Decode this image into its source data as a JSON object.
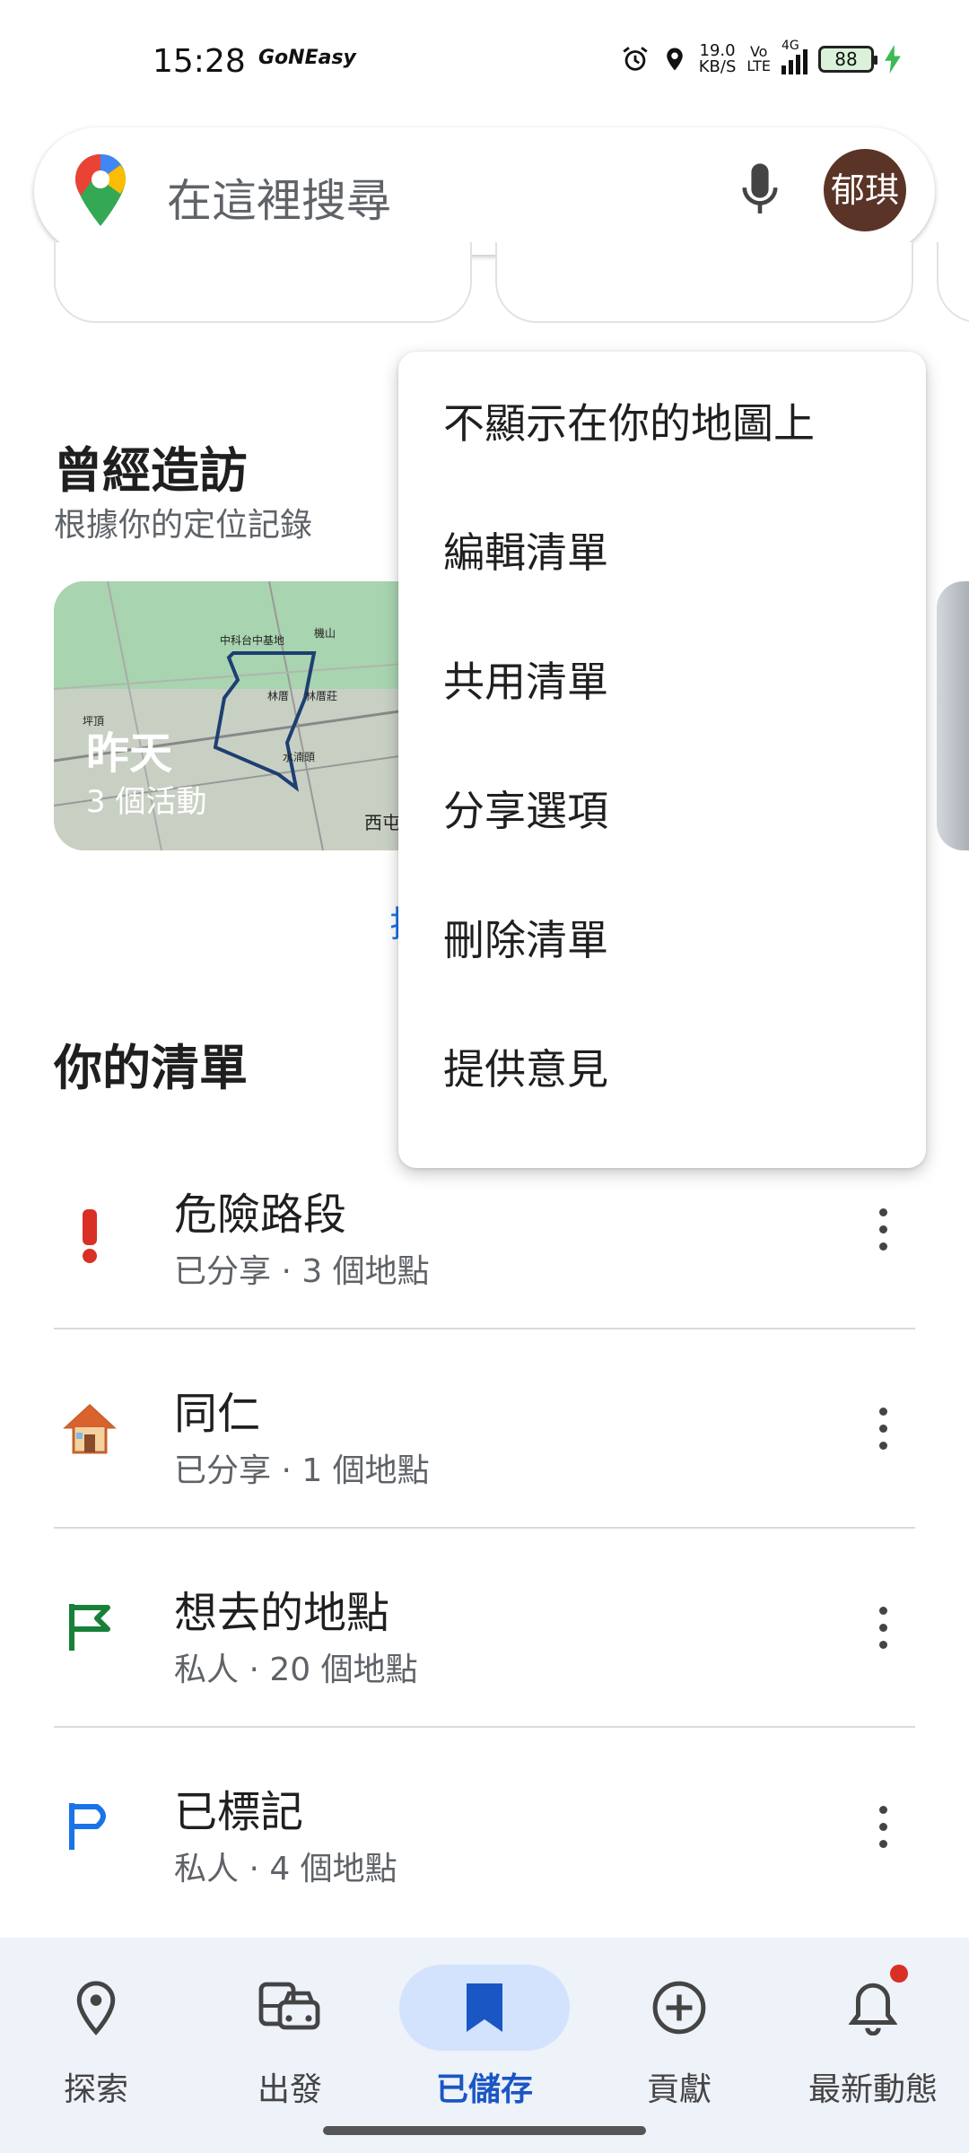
{
  "status_bar": {
    "time": "15:28",
    "app_logo_text": "GoNEasy",
    "net_speed_value": "19.0",
    "net_speed_unit": "KB/S",
    "volte_top": "Vo",
    "volte_bottom": "LTE",
    "signal_label": "4G",
    "battery": "88",
    "icons": [
      "alarm-icon",
      "location-icon",
      "signal-icon",
      "charging-icon"
    ]
  },
  "search": {
    "placeholder": "在這裡搜尋",
    "avatar_text": "郁琪",
    "icons": [
      "maps-pin-icon",
      "mic-icon"
    ]
  },
  "visited": {
    "title": "曾經造訪",
    "subtitle": "根據你的定位記錄",
    "card": {
      "day": "昨天",
      "activities": "3 個活動",
      "map_labels": [
        "中科台中基地",
        "機山",
        "林厝",
        "林厝莊",
        "水湳頭",
        "坪頂",
        "西屯"
      ]
    },
    "link_partial": "排"
  },
  "lists": {
    "title": "你的清單",
    "items": [
      {
        "name": "危險路段",
        "meta": "已分享 · 3 個地點",
        "icon": "exclamation-icon",
        "icon_color": "#d93025"
      },
      {
        "name": "同仁",
        "meta": "已分享 · 1 個地點",
        "icon": "house-icon",
        "icon_color": "#e07a3a"
      },
      {
        "name": "想去的地點",
        "meta": "私人 · 20 個地點",
        "icon": "flag-icon",
        "icon_color": "#188038"
      },
      {
        "name": "已標記",
        "meta": "私人 · 4 個地點",
        "icon": "flag-outline-icon",
        "icon_color": "#1a73e8"
      }
    ]
  },
  "menu": {
    "items": [
      "不顯示在你的地圖上",
      "編輯清單",
      "共用清單",
      "分享選項",
      "刪除清單",
      "提供意見"
    ]
  },
  "bottom_nav": {
    "items": [
      {
        "label": "探索",
        "icon": "explore-pin-icon"
      },
      {
        "label": "出發",
        "icon": "commute-icon"
      },
      {
        "label": "已儲存",
        "icon": "bookmark-icon",
        "active": true
      },
      {
        "label": "貢獻",
        "icon": "add-circle-icon"
      },
      {
        "label": "最新動態",
        "icon": "bell-icon",
        "badge": true
      }
    ],
    "accent": "#1a56c4",
    "badge_color": "#d93025"
  }
}
